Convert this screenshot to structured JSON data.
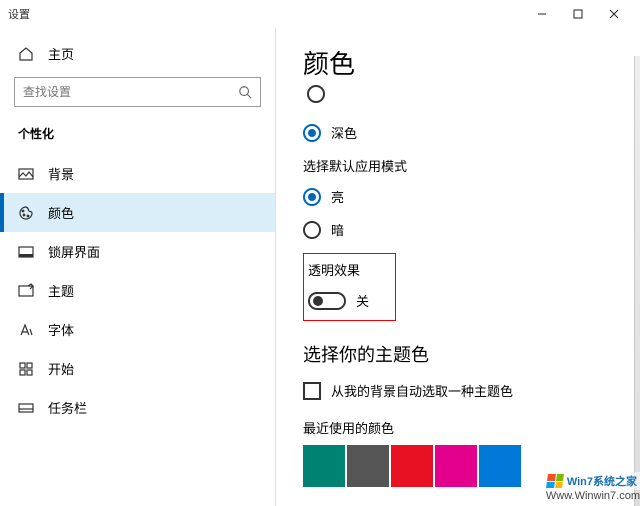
{
  "titlebar": {
    "title": "设置"
  },
  "sidebar": {
    "home": "主页",
    "search_placeholder": "查找设置",
    "section": "个性化",
    "items": [
      {
        "label": "背景"
      },
      {
        "label": "颜色"
      },
      {
        "label": "锁屏界面"
      },
      {
        "label": "主题"
      },
      {
        "label": "字体"
      },
      {
        "label": "开始"
      },
      {
        "label": "任务栏"
      }
    ]
  },
  "content": {
    "page_title": "颜色",
    "radio_dark": "深色",
    "app_mode_title": "选择默认应用模式",
    "radio_light": "亮",
    "radio_dark2": "暗",
    "transparency_title": "透明效果",
    "toggle_off": "关",
    "accent_title": "选择你的主题色",
    "auto_pick": "从我的背景自动选取一种主题色",
    "recent_label": "最近使用的颜色",
    "swatches": [
      "#008272",
      "#555555",
      "#e81123",
      "#e3008c",
      "#0078d7"
    ]
  },
  "watermark": {
    "brand": "Win7系统之家",
    "url": "Www.Winwin7.com"
  }
}
